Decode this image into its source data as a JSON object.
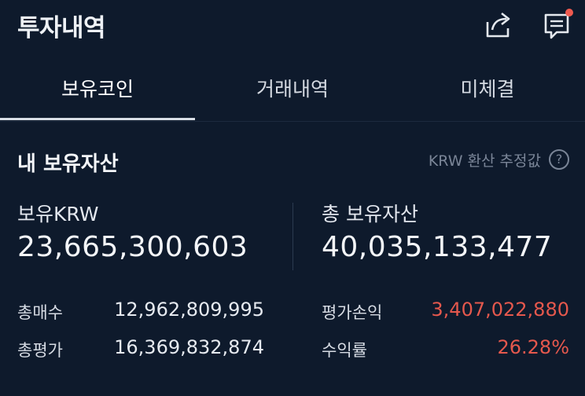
{
  "header": {
    "title": "투자내역"
  },
  "tabs": [
    {
      "label": "보유코인",
      "active": true
    },
    {
      "label": "거래내역",
      "active": false
    },
    {
      "label": "미체결",
      "active": false
    }
  ],
  "summary": {
    "title": "내 보유자산",
    "note": "KRW 환산 추정값",
    "help_glyph": "?",
    "krw_label": "보유KRW",
    "krw_value": "23,665,300,603",
    "total_label": "총 보유자산",
    "total_value": "40,035,133,477"
  },
  "details": {
    "buy_label": "총매수",
    "buy_value": "12,962,809,995",
    "eval_label": "총평가",
    "eval_value": "16,369,832,874",
    "pl_label": "평가손익",
    "pl_value": "3,407,022,880",
    "roi_label": "수익률",
    "roi_value": "26.28%"
  },
  "colors": {
    "background": "#0e1a2c",
    "profit_red": "#e5584d",
    "notification_dot": "#f05a4f"
  },
  "icons": [
    "share-icon",
    "message-icon",
    "help-icon"
  ]
}
